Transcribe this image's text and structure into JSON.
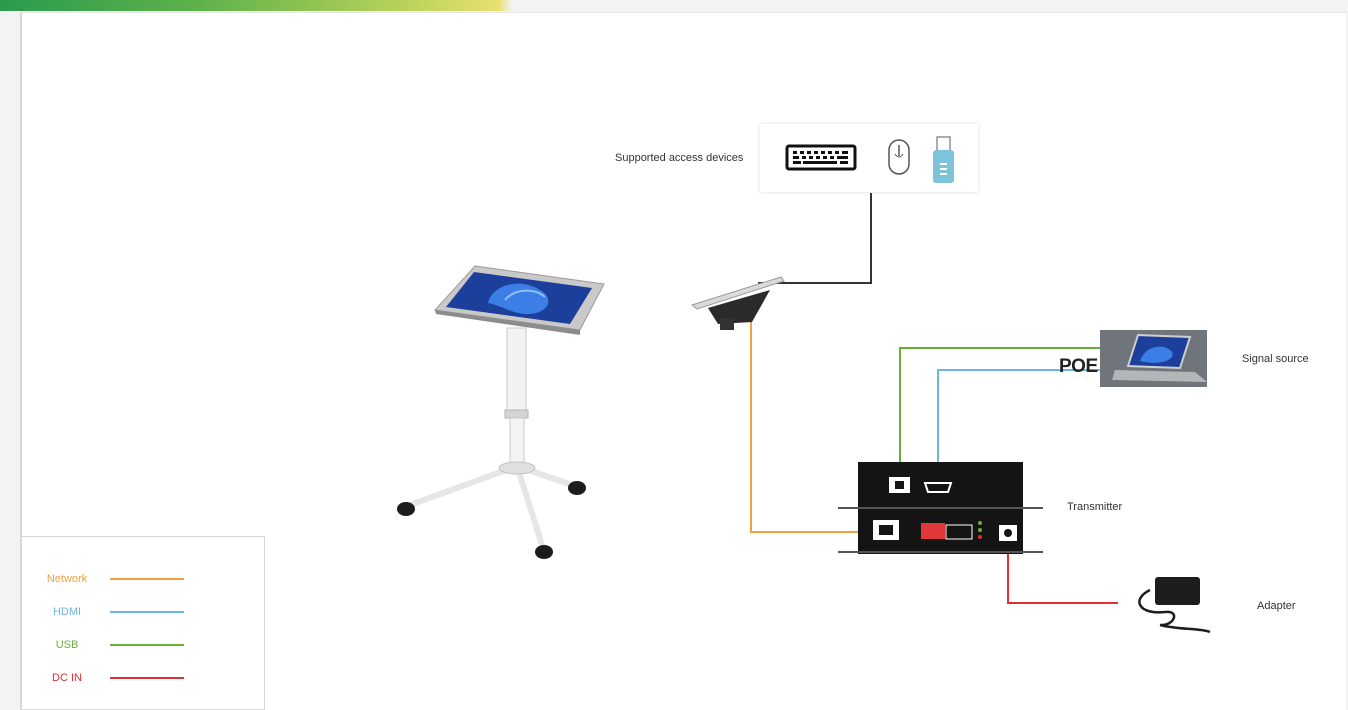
{
  "labels": {
    "access_devices": "Supported access devices",
    "signal_source": "Signal source",
    "poe": "POE",
    "transmitter": "Transmitter",
    "adapter": "Adapter"
  },
  "legend": [
    {
      "label": "Network",
      "color": "#f0a040"
    },
    {
      "label": "HDMI",
      "color": "#6ab8e0"
    },
    {
      "label": "USB",
      "color": "#6cae3c"
    },
    {
      "label": "DC IN",
      "color": "#e03030"
    }
  ],
  "icons": [
    "keyboard-icon",
    "mouse-icon",
    "usb-drive-icon"
  ]
}
